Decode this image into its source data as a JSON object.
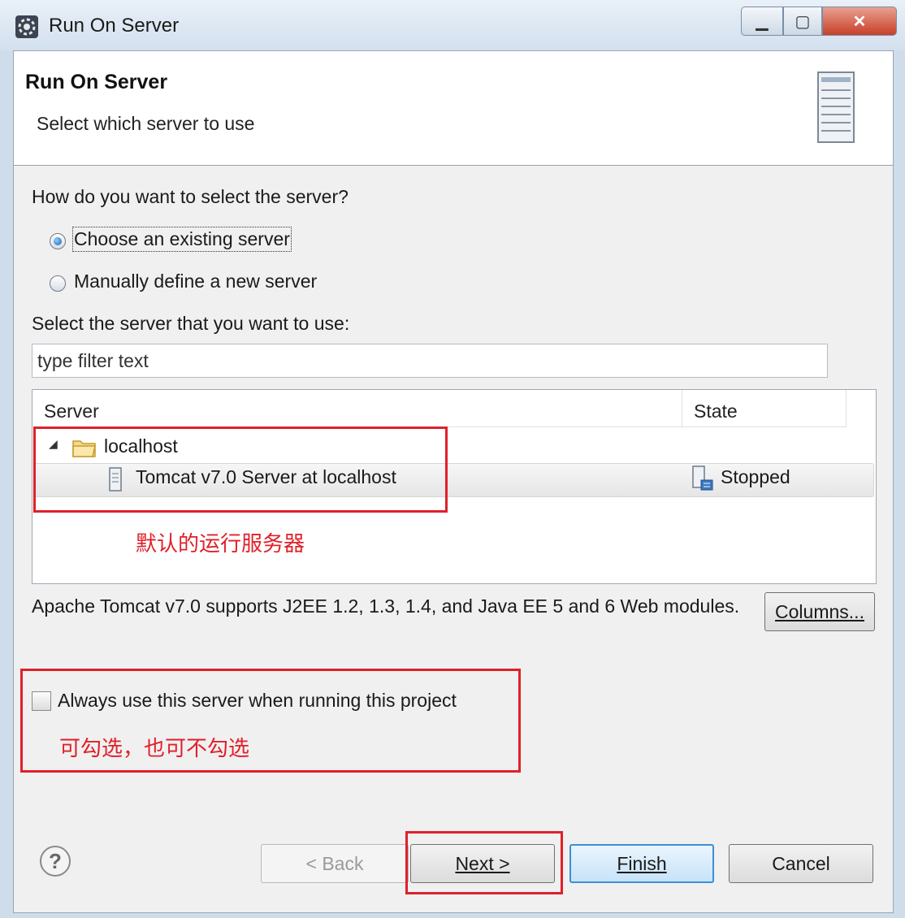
{
  "window": {
    "title": "Run On Server"
  },
  "header": {
    "title": "Run On Server",
    "subtitle": "Select which server to use"
  },
  "question": "How do you want to select the server?",
  "options": [
    {
      "label": "Choose an existing server",
      "selected": true
    },
    {
      "label": "Manually define a new server",
      "selected": false
    }
  ],
  "select_label": "Select the server that you want to use:",
  "filter": {
    "placeholder": "type filter text",
    "value": "type filter text"
  },
  "table": {
    "columns": [
      "Server",
      "State"
    ],
    "group": "localhost",
    "rows": [
      {
        "name": "Tomcat v7.0 Server at localhost",
        "state": "Stopped"
      }
    ]
  },
  "annotation_default": "默认的运行服务器",
  "description": "Apache Tomcat v7.0 supports J2EE 1.2, 1.3, 1.4, and Java EE 5 and 6 Web modules.",
  "columns_button": "Columns...",
  "always_use": {
    "label": "Always use this server when running this project",
    "checked": false
  },
  "annotation_optional": "可勾选，也可不勾选",
  "buttons": {
    "back": "< Back",
    "next": "Next >",
    "finish": "Finish",
    "cancel": "Cancel"
  },
  "colors": {
    "annotation_red": "#e0202a",
    "default_button_border": "#3c8fd6"
  }
}
